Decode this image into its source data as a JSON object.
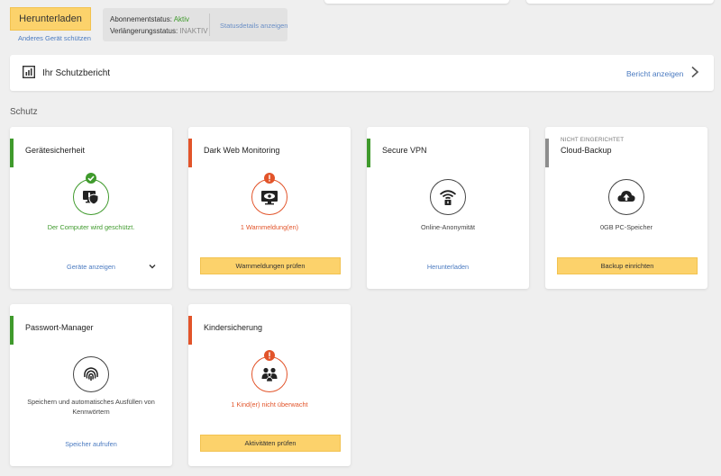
{
  "top": {
    "download_button": "Herunterladen",
    "protect_other_device": "Anderes Gerät schützen"
  },
  "subscription": {
    "status_label": "Abonnementstatus:",
    "status_value": "Aktiv",
    "renewal_label": "Verlängerungsstatus:",
    "renewal_value": "INAKTIV",
    "details_link": "Statusdetails anzeigen"
  },
  "report": {
    "title": "Ihr Schutzbericht",
    "link": "Bericht anzeigen"
  },
  "section": {
    "label": "Schutz"
  },
  "cards": [
    {
      "title": "Gerätesicherheit",
      "status": "Der Computer wird geschützt.",
      "footer_link": "Geräte anzeigen",
      "state": "ok",
      "icon": "shield-monitor-icon"
    },
    {
      "title": "Dark Web Monitoring",
      "status": "1 Warnmeldung(en)",
      "footer_button": "Warnmeldungen prüfen",
      "state": "warning",
      "icon": "eye-monitor-icon"
    },
    {
      "title": "Secure VPN",
      "status": "Online-Anonymität",
      "footer_link": "Herunterladen",
      "state": "ok",
      "icon": "wifi-lock-icon"
    },
    {
      "tag": "NICHT EINGERICHTET",
      "title": "Cloud-Backup",
      "status": "0GB PC-Speicher",
      "footer_button": "Backup einrichten",
      "state": "inactive",
      "icon": "cloud-upload-icon"
    },
    {
      "title": "Passwort-Manager",
      "status": "Speichern und automatisches Ausfüllen von Kennwörtern",
      "footer_link": "Speicher aufrufen",
      "state": "ok",
      "icon": "fingerprint-icon"
    },
    {
      "title": "Kindersicherung",
      "status": "1 Kind(er) nicht überwacht",
      "footer_button": "Aktivitäten prüfen",
      "state": "warning",
      "icon": "family-icon"
    }
  ],
  "colors": {
    "ok": "#3f9a2c",
    "warning": "#e2542a",
    "inactive": "#8d8d8d",
    "accent_button": "#fcd26b",
    "link": "#4a7ac0"
  }
}
